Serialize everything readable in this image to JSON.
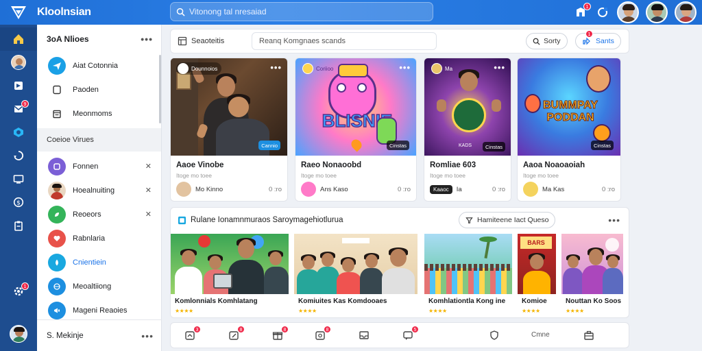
{
  "header": {
    "title": "Kloolnsian",
    "search_placeholder": "Vitonong tal nresaiad",
    "notif_badge": "1",
    "accent": "#1f6fd6"
  },
  "rail": {
    "icons": [
      "home-icon",
      "profile-avatar",
      "flag-icon",
      "inbox-icon",
      "cube-icon",
      "recycle-icon",
      "monitor-icon",
      "dollar-icon",
      "clipboard-icon"
    ],
    "badge": "9",
    "bottom_badge": "1"
  },
  "sidebar": {
    "header": "3oA Nlioes",
    "items": [
      {
        "label": "Aiat Cotonnia",
        "icon": "plane-icon"
      },
      {
        "label": "Paoden",
        "icon": "bookmark-icon"
      },
      {
        "label": "Meonmoms",
        "icon": "calendar-icon"
      }
    ],
    "section": "Coeioe Virues",
    "sub_items": [
      {
        "label": "Fonnen",
        "icon": "letter-f-icon",
        "color": "#7b5fd6"
      },
      {
        "label": "Hoealnuiting",
        "icon": "person-avatar",
        "color": "#d6a27a"
      },
      {
        "label": "Reoeors",
        "icon": "leaf-icon",
        "color": "#34b45a"
      },
      {
        "label": "Rabnlaria",
        "icon": "heart-icon",
        "color": "#e8524a"
      },
      {
        "label": "Cnientiein",
        "icon": "droplet-icon",
        "color": "#19a8e0"
      },
      {
        "label": "Meoaltiiong",
        "icon": "globe-icon",
        "color": "#1d8fe0"
      },
      {
        "label": "Mageni Reaoies",
        "icon": "megaphone-icon",
        "color": "#1d8fe0"
      }
    ],
    "footer_name": "S. Mekinje"
  },
  "toolbar": {
    "label": "Seaoteitis",
    "input_placeholder": "Reanq Komgnaes scands",
    "sort_label": "Sorty",
    "share_label": "Sants",
    "share_badge": "1"
  },
  "cards": [
    {
      "chip": "Dounnoios",
      "title": "Aaoe Vinobe",
      "subtitle": "Itoge mo toee",
      "author": "Mo Kinno",
      "count": "0 :ro",
      "tag": "Cannio"
    },
    {
      "chip": "Coriioo",
      "title": "Raeo Nonaoobd",
      "subtitle": "Itoge mo toee",
      "author": "Ans Kaso",
      "count": "0 :ro",
      "tag": "Cinstas",
      "art": "BLISNIE"
    },
    {
      "chip": "Ma",
      "title": "Romliae 603",
      "subtitle": "Itoge mo toee",
      "author": "Ia",
      "count": "0 :ro",
      "tag": "Cinstas",
      "tag2": "KADS",
      "pill": "Kaaoc"
    },
    {
      "chip": "",
      "title": "Aaoa Noaoaoiah",
      "subtitle": "Itoge mo toee",
      "author": "Ma Kas",
      "count": "0 :ro",
      "tag": "Cinstas",
      "art": "BUMMPAY PODDAN"
    }
  ],
  "recommend": {
    "title": "Rulane Ionamnmuraos Saroymagehiotlurua",
    "filter_label": "Hamiteene Iact Queso",
    "cards": [
      {
        "title": "Komlonnials Komhlatang",
        "stars": "★★★★"
      },
      {
        "title": "Komiuites Kas Komdooaes",
        "stars": "★★★★"
      },
      {
        "title": "Komhlationtla Kong ine",
        "stars": "★★★★"
      },
      {
        "title": "Komioe",
        "stars": "★★★★"
      },
      {
        "title": "Nouttan Ko Soos",
        "stars": "★★★★"
      }
    ],
    "art": "BARS"
  },
  "bottombar": {
    "icons": [
      "share-icon",
      "edit-icon",
      "gift-icon",
      "photo-icon",
      "inbox-icon",
      "chat-icon",
      "shield-icon",
      "briefcase-icon"
    ],
    "badges": [
      "3",
      "8",
      "8",
      "8",
      "",
      "5",
      "",
      ""
    ],
    "text": "Cmne"
  }
}
